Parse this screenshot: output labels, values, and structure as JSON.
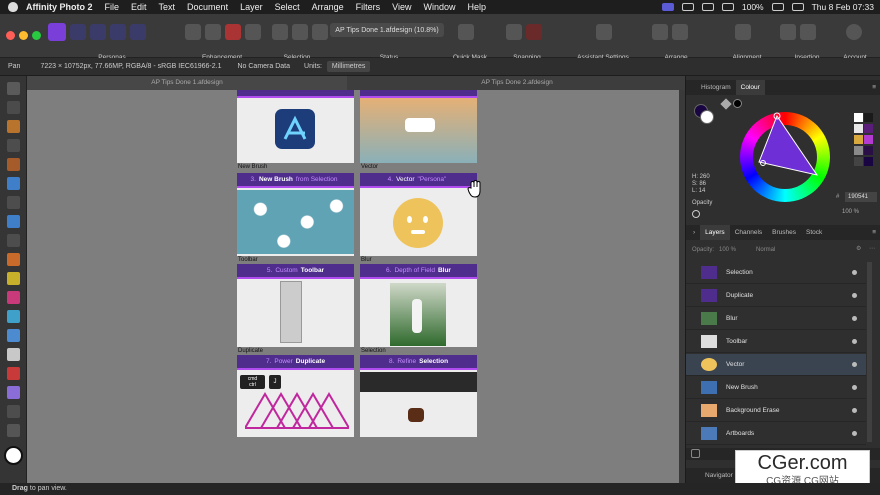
{
  "menubar": {
    "app": "Affinity Photo 2",
    "items": [
      "File",
      "Edit",
      "Text",
      "Document",
      "Layer",
      "Select",
      "Arrange",
      "Filters",
      "View",
      "Window",
      "Help"
    ],
    "battery": "100%",
    "datetime": "Thu 8 Feb  07:33"
  },
  "toolbar": {
    "labels": {
      "personas": "Personas",
      "enhancement": "Enhancement",
      "selection": "Selection",
      "status": "Status",
      "quickmask": "Quick Mask",
      "snapping": "Snapping",
      "assistant": "Assistant Settings",
      "arrange": "Arrange",
      "alignment": "Alignment",
      "insertion": "Insertion",
      "account": "Account"
    },
    "status_text": "AP Tips Done 1.afdesign (10.8%)"
  },
  "context": {
    "tool": "Pan",
    "info": "7223 × 10752px, 77.66MP, RGBA/8 - sRGB IEC61966-2.1",
    "camera": "No Camera Data",
    "units_label": "Units:",
    "units_value": "Millimetres"
  },
  "doctabs": [
    "AP Tips Done 1.afdesign",
    "AP Tips Done 2.afdesign"
  ],
  "cards": [
    {
      "num": "",
      "pre": "",
      "bold": "",
      "caption": "New Brush"
    },
    {
      "num": "",
      "pre": "",
      "bold": "",
      "caption": "Vector"
    },
    {
      "num": "3.",
      "pre": "New Brush",
      "bold": "from Selection",
      "caption": "Toolbar"
    },
    {
      "num": "4.",
      "pre": "Vector",
      "bold": "\"Persona\"",
      "caption": "Blur"
    },
    {
      "num": "5.",
      "pre": "Custom",
      "bold": "Toolbar",
      "caption": "Duplicate"
    },
    {
      "num": "6.",
      "pre": "Depth of Field",
      "bold": "Blur",
      "caption": "Selection"
    },
    {
      "num": "7.",
      "pre": "Power",
      "bold": "Duplicate",
      "caption": ""
    },
    {
      "num": "8.",
      "pre": "Refine",
      "bold": "Selection",
      "caption": ""
    }
  ],
  "keycaps": [
    "cmd\nctrl",
    "J"
  ],
  "panel": {
    "top_tabs": [
      "Histogram",
      "Colour"
    ],
    "hsl": [
      "H: 260",
      "S: 86",
      "L: 14"
    ],
    "opacity_label": "Opacity",
    "hex": "190541",
    "opacity_pct": "100 %",
    "layer_tabs": [
      "Layers",
      "Channels",
      "Brushes",
      "Stock"
    ],
    "layer_opacity_label": "Opacity:",
    "layer_opacity": "100 %",
    "blend": "Normal",
    "layers": [
      "Selection",
      "Duplicate",
      "Blur",
      "Toolbar",
      "Vector",
      "New Brush",
      "Background Erase",
      "Artboards"
    ],
    "bottom_tab": "Navigator"
  },
  "statusbar": {
    "bold": "Drag",
    "rest": "to pan view."
  },
  "watermark": {
    "big": "CGer.com",
    "small": "CG资源  CG网站"
  },
  "colors": {
    "accent": "#4f2d8d",
    "accent_line": "#b14cf0",
    "canvas": "#7e7e7e",
    "panel": "#2f2f2f"
  }
}
